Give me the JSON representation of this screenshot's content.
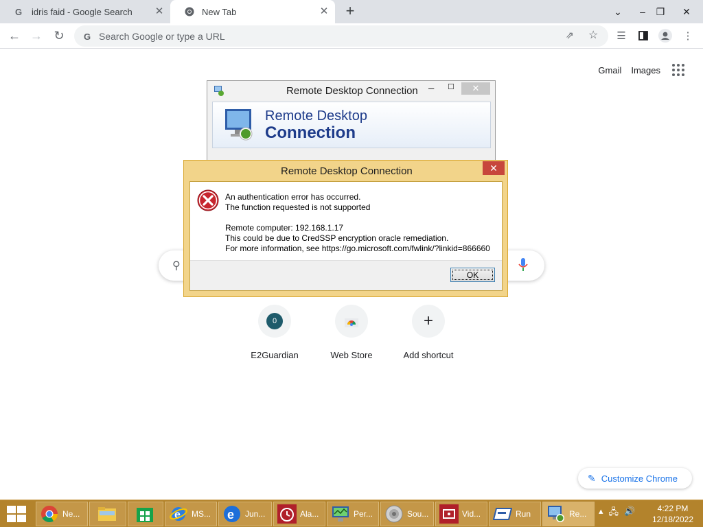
{
  "browser": {
    "tabs": [
      {
        "title": "idris faid - Google Search"
      },
      {
        "title": "New Tab"
      }
    ],
    "omnibox": {
      "placeholder": "Search Google or type a URL"
    }
  },
  "ntp": {
    "links": {
      "gmail": "Gmail",
      "images": "Images"
    },
    "shortcuts": [
      {
        "label": "E2Guardian",
        "badge": "0"
      },
      {
        "label": "Web Store"
      },
      {
        "label": "Add shortcut"
      }
    ],
    "customize_label": "Customize Chrome"
  },
  "rdc_window": {
    "title": "Remote Desktop Connection",
    "banner_line1": "Remote Desktop",
    "banner_line2": "Connection"
  },
  "error_dialog": {
    "title": "Remote Desktop Connection",
    "lines": [
      "An authentication error has occurred.",
      "The function requested is not supported",
      "",
      "Remote computer: 192.168.1.17",
      "This could be due to CredSSP encryption oracle remediation.",
      "For more information, see https://go.microsoft.com/fwlink/?linkid=866660"
    ],
    "ok_label": "OK"
  },
  "taskbar": {
    "items": [
      {
        "label": "Ne..."
      },
      {
        "label": ""
      },
      {
        "label": ""
      },
      {
        "label": "MS..."
      },
      {
        "label": "Jun..."
      },
      {
        "label": "Ala..."
      },
      {
        "label": "Per..."
      },
      {
        "label": "Sou..."
      },
      {
        "label": "Vid..."
      },
      {
        "label": "Run"
      },
      {
        "label": "Re..."
      }
    ],
    "time": "4:22 PM",
    "date": "12/18/2022"
  }
}
